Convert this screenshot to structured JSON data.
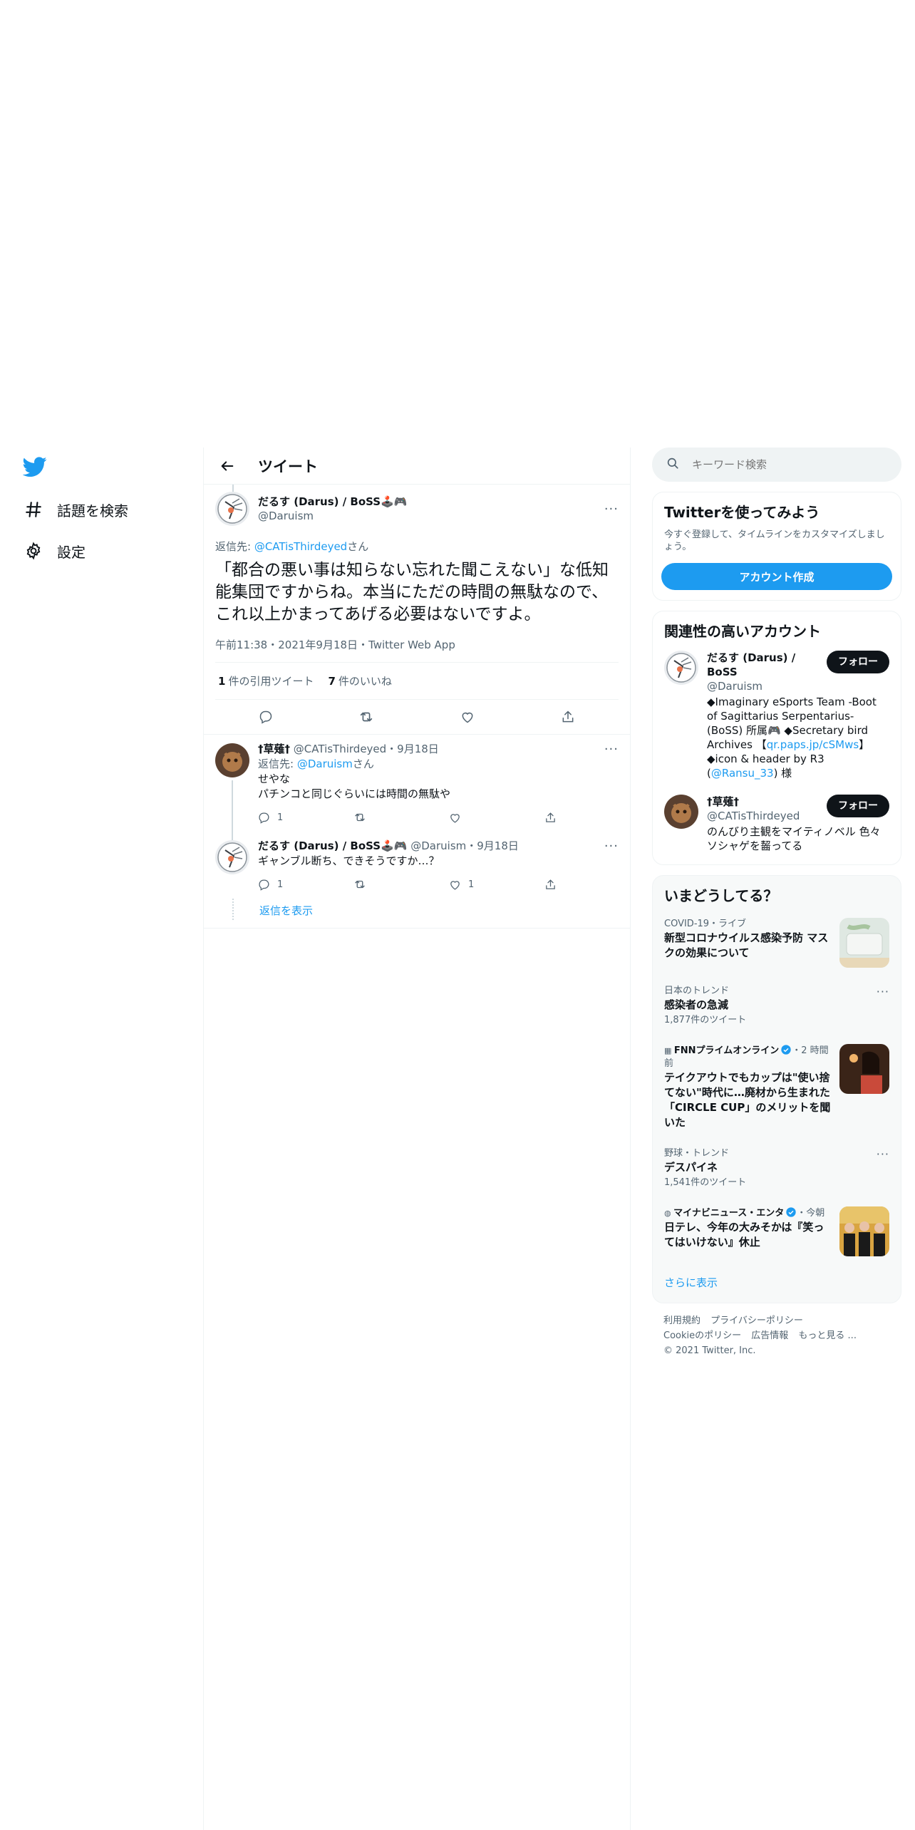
{
  "nav": {
    "explore_label": "話題を検索",
    "settings_label": "設定"
  },
  "header": {
    "title": "ツイート"
  },
  "focal_tweet": {
    "name": "だるす (Darus) / BoSS🕹️🎮",
    "handle": "@Daruism",
    "reply_prefix": "返信先: ",
    "reply_to": "@CATisThirdeyed",
    "reply_suffix": "さん",
    "text": "「都合の悪い事は知らない忘れた聞こえない」な低知能集団ですからね。本当にただの時間の無駄なので、これ以上かまってあげる必要はないですよ。",
    "meta": "午前11:38・2021年9月18日・Twitter Web App",
    "quote_count": "1",
    "quote_label": "件の引用ツイート",
    "like_count": "7",
    "like_label": "件のいいね"
  },
  "replies": [
    {
      "name": "†草薙†",
      "handle": "@CATisThirdeyed",
      "date": "・9月18日",
      "reply_prefix": "返信先: ",
      "reply_to": "@Daruism",
      "reply_suffix": "さん",
      "text_line1": "せやな",
      "text_line2": "パチンコと同じぐらいには時間の無駄や",
      "reply_count": "1",
      "like_count": ""
    },
    {
      "name": "だるす (Darus) / BoSS🕹️🎮",
      "handle": "@Daruism",
      "date": "・9月18日",
      "text_line1": "ギャンブル断ち、できそうですか…？",
      "reply_count": "1",
      "like_count": "1"
    }
  ],
  "show_replies_label": "返信を表示",
  "search": {
    "placeholder": "キーワード検索"
  },
  "signup": {
    "title": "Twitterを使ってみよう",
    "subtitle": "今すぐ登録して、タイムラインをカスタマイズしましょう。",
    "button": "アカウント作成"
  },
  "related": {
    "title": "関連性の高いアカウント",
    "accounts": [
      {
        "name": "だるす (Darus) / BoSS",
        "handle": "@Daruism",
        "follow": "フォロー",
        "bio_part1": "◆Imaginary eSports Team -Boot of Sagittarius Serpentarius- (BoSS) 所属🎮 ◆Secretary bird Archives 【",
        "bio_link1": "qr.paps.jp/cSMws",
        "bio_part2": "】 ◆icon & header by R3 (",
        "bio_link2": "@Ransu_33",
        "bio_part3": ") 様"
      },
      {
        "name": "†草薙†",
        "handle": "@CATisThirdeyed",
        "follow": "フォロー",
        "bio": "のんびり主観をマイティノベル 色々ソシャゲを齧ってる"
      }
    ]
  },
  "trends": {
    "title": "いまどうしてる？",
    "items": [
      {
        "context": "COVID-19・ライブ",
        "name": "新型コロナウイルス感染予防 マスクの効果について"
      },
      {
        "context": "日本のトレンド",
        "name": "感染者の急減",
        "count": "1,877件のツイート"
      },
      {
        "source": "FNNプライムオンライン",
        "time": "・2 時間前",
        "name": "テイクアウトでもカップは\"使い捨てない\"時代に…廃材から生まれた「CIRCLE CUP」のメリットを聞いた"
      },
      {
        "context": "野球・トレンド",
        "name": "デスパイネ",
        "count": "1,541件のツイート"
      },
      {
        "source": "マイナビニュース・エンタ",
        "time": "・今朝",
        "name": "日テレ、今年の大みそかは『笑ってはいけない』休止"
      }
    ],
    "show_more": "さらに表示"
  },
  "footer": {
    "terms": "利用規約",
    "privacy": "プライバシーポリシー",
    "cookie": "Cookieのポリシー",
    "ads": "広告情報",
    "more": "もっと見る ...",
    "copyright": "© 2021 Twitter, Inc."
  },
  "colors": {
    "accent": "#1d9bf0",
    "text": "#0f1419",
    "muted": "#536471"
  }
}
